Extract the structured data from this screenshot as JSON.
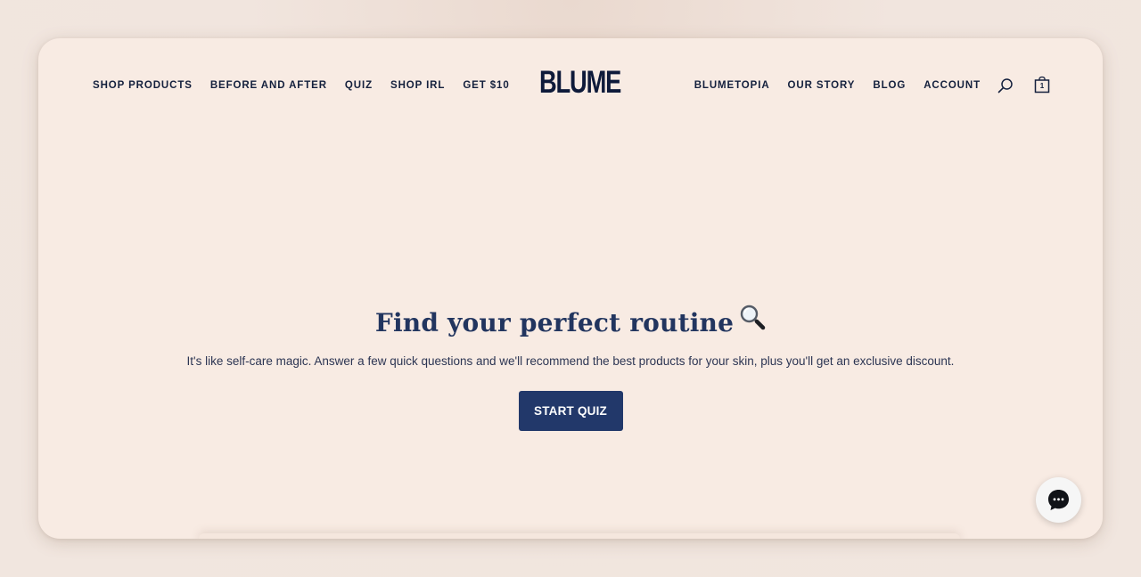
{
  "brand": {
    "logo_text": "BLUME"
  },
  "nav_left": [
    {
      "label": "SHOP PRODUCTS"
    },
    {
      "label": "BEFORE AND AFTER"
    },
    {
      "label": "QUIZ"
    },
    {
      "label": "SHOP IRL"
    },
    {
      "label": "GET $10"
    }
  ],
  "nav_right": [
    {
      "label": "BLUMETOPIA"
    },
    {
      "label": "OUR STORY"
    },
    {
      "label": "BLOG"
    },
    {
      "label": "ACCOUNT"
    }
  ],
  "icons": {
    "search": "search-icon",
    "cart": "shopping-bag-icon",
    "chat": "chat-bubble-icon"
  },
  "cart": {
    "count": "1"
  },
  "hero": {
    "title": "Find your perfect routine",
    "title_emoji": "🔍",
    "subtitle": "It's like self-care magic. Answer a few quick questions and we'll recommend the best products for your skin, plus you'll get an exclusive discount.",
    "cta_label": "START QUIZ"
  },
  "colors": {
    "page_bg": "#f0e4dd",
    "card_bg": "#f8ebe3",
    "navy": "#22386a",
    "text_dark": "#14203d"
  }
}
